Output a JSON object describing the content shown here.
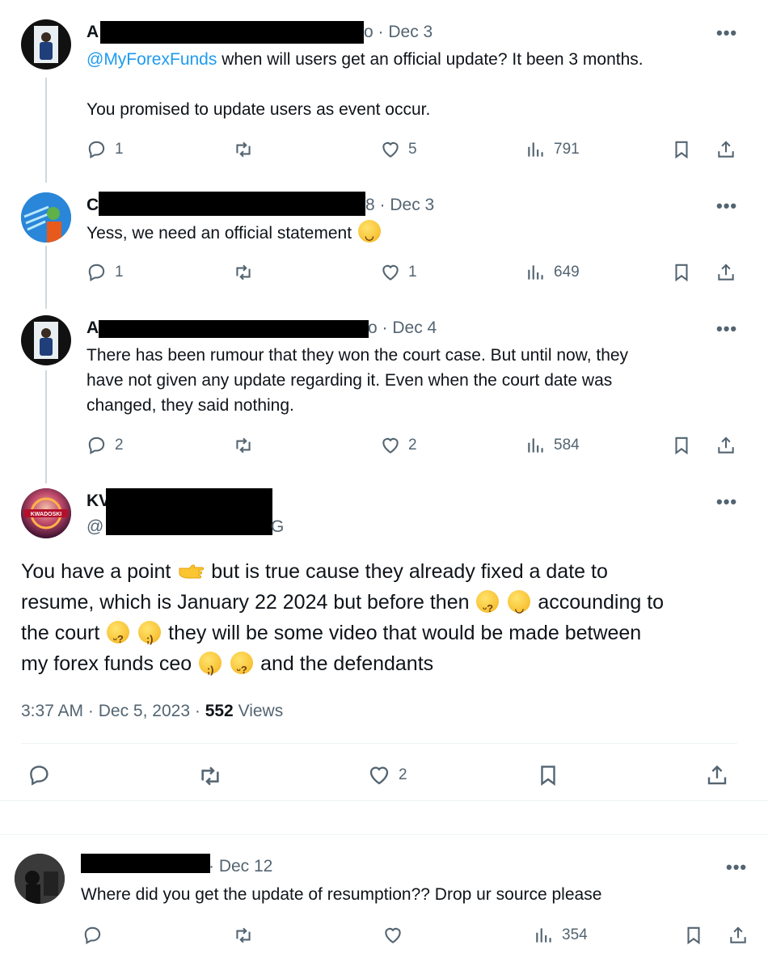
{
  "tweets": [
    {
      "initial": "A",
      "handle_suffix": "o",
      "date": "· Dec 3",
      "mention": "@MyForexFunds",
      "text_line1": " when will users  get an official update? It been 3 months.",
      "text_line2": "You promised to update users as event occur.",
      "replies": "1",
      "retweets": "",
      "likes": "5",
      "views": "791"
    },
    {
      "initial": "C",
      "handle_suffix": "8",
      "date": "· Dec 3",
      "text": "Yess, we need an official statement",
      "emoji": "smiling-face-icon",
      "replies": "1",
      "retweets": "",
      "likes": "1",
      "views": "649"
    },
    {
      "initial": "A",
      "handle_suffix": "o",
      "date": "· Dec 4",
      "text_line1": "There has been rumour that they won the court case. But until now, they",
      "text_line2": "have not given any update regarding it. Even when the court date was",
      "text_line3": "changed, they said nothing.",
      "replies": "2",
      "retweets": "",
      "likes": "2",
      "views": "584"
    }
  ],
  "main_tweet": {
    "name_initial": "KV",
    "handle_prefix": "@",
    "handle_suffix": "G",
    "avatar_label": "KWADOSKI",
    "line1_a": "You have a point",
    "line1_b": "but is true cause they already fixed a date to",
    "line2_a": "resume, which is January 22 2024 but before then",
    "line2_b": "accounding to",
    "line3_a": "the court",
    "line3_b": "they will be some video that would be made between",
    "line4_a": "my forex funds ceo",
    "line4_b": "and the defendants",
    "time": "3:37 AM",
    "dot": "·",
    "date": "Dec 5, 2023",
    "dot2": "·",
    "views_count": "552",
    "views_label": "Views",
    "likes": "2"
  },
  "reply": {
    "date": "· Dec 12",
    "text": "Where did you get the update of resumption?? Drop ur source please",
    "views": "354"
  },
  "more_label": "•••",
  "colors": {
    "accent": "#1d9bf0",
    "muted": "#536471",
    "line": "#cfd9de"
  }
}
